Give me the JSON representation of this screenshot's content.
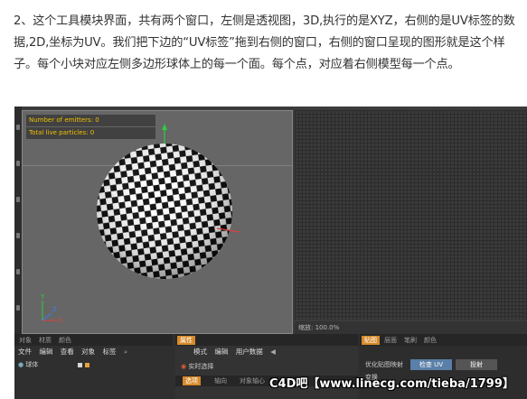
{
  "intro_text": "2、这个工具模块界面，共有两个窗口，左侧是透视图，3D,执行的是XYZ，右侧的是UV标签的数据,2D,坐标为UV。我们把下边的“UV标签”拖到右侧的窗口，右侧的窗口呈现的图形就是这个样子。每个小块对应左侧多边形球体上的每一个面。每个点，对应着右侧模型每一个点。",
  "viewport": {
    "hud_emitters": "Number of emitters: 0",
    "hud_particles": "Total live particles: 0",
    "axis_y": "Y",
    "axis_z": "Z",
    "axis_x": "X"
  },
  "uv_status": "缩放: 100.0%",
  "left_panel": {
    "tabs": [
      "对象",
      "材质",
      "颜色"
    ],
    "menu": [
      "文件",
      "编辑",
      "查看",
      "对象",
      "标签"
    ],
    "object_name": "球体"
  },
  "attr_panel": {
    "tab": "属性",
    "menu": [
      "模式",
      "编辑",
      "用户数据"
    ],
    "checkbox_label": "实时选择",
    "subtabs": [
      "选项",
      "轴向",
      "对象轴心"
    ]
  },
  "right_panel": {
    "tabs": [
      "贴图",
      "层面",
      "笔刷",
      "颜色"
    ],
    "row_label": "优化贴图映射",
    "btn_uv": "检查 UV",
    "btn_proj": "投射",
    "bottom_label": "变换"
  },
  "watermark": "C4D吧【www.linecg.com/tieba/1799】",
  "colors": {
    "accent": "#d68a2a",
    "hud_text": "#f0c000",
    "axis_y": "#2ecc40",
    "axis_x": "#e04040",
    "axis_z": "#3a7bff"
  }
}
